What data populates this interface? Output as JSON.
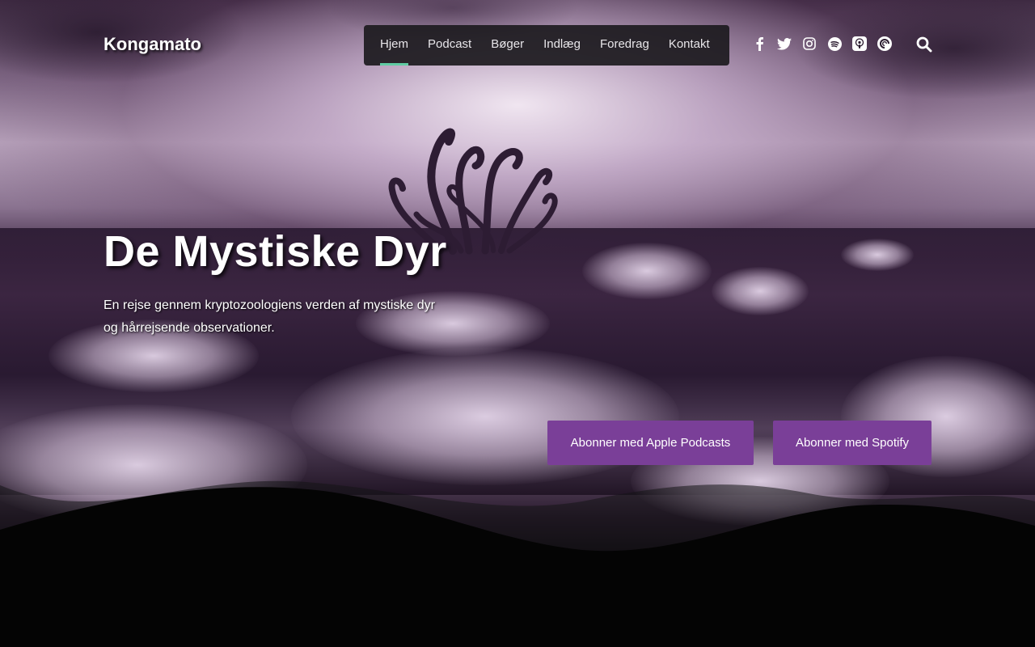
{
  "site": {
    "logo": "Kongamato"
  },
  "nav": {
    "items": [
      {
        "label": "Hjem",
        "active": true
      },
      {
        "label": "Podcast",
        "active": false
      },
      {
        "label": "Bøger",
        "active": false
      },
      {
        "label": "Indlæg",
        "active": false
      },
      {
        "label": "Foredrag",
        "active": false
      },
      {
        "label": "Kontakt",
        "active": false
      }
    ],
    "active_color": "#5fcca3"
  },
  "social": {
    "icons": [
      "facebook-icon",
      "twitter-icon",
      "instagram-icon",
      "spotify-icon",
      "apple-podcasts-icon",
      "pocket-casts-icon"
    ],
    "search_icon": "search-icon"
  },
  "hero": {
    "title": "De Mystiske Dyr",
    "subtitle": "En rejse gennem kryptozoologiens verden af mystiske dyr og hårrejsende observationer."
  },
  "buttons": {
    "apple": "Abonner med Apple Podcasts",
    "spotify": "Abonner med Spotify",
    "color": "#7a3f98"
  }
}
